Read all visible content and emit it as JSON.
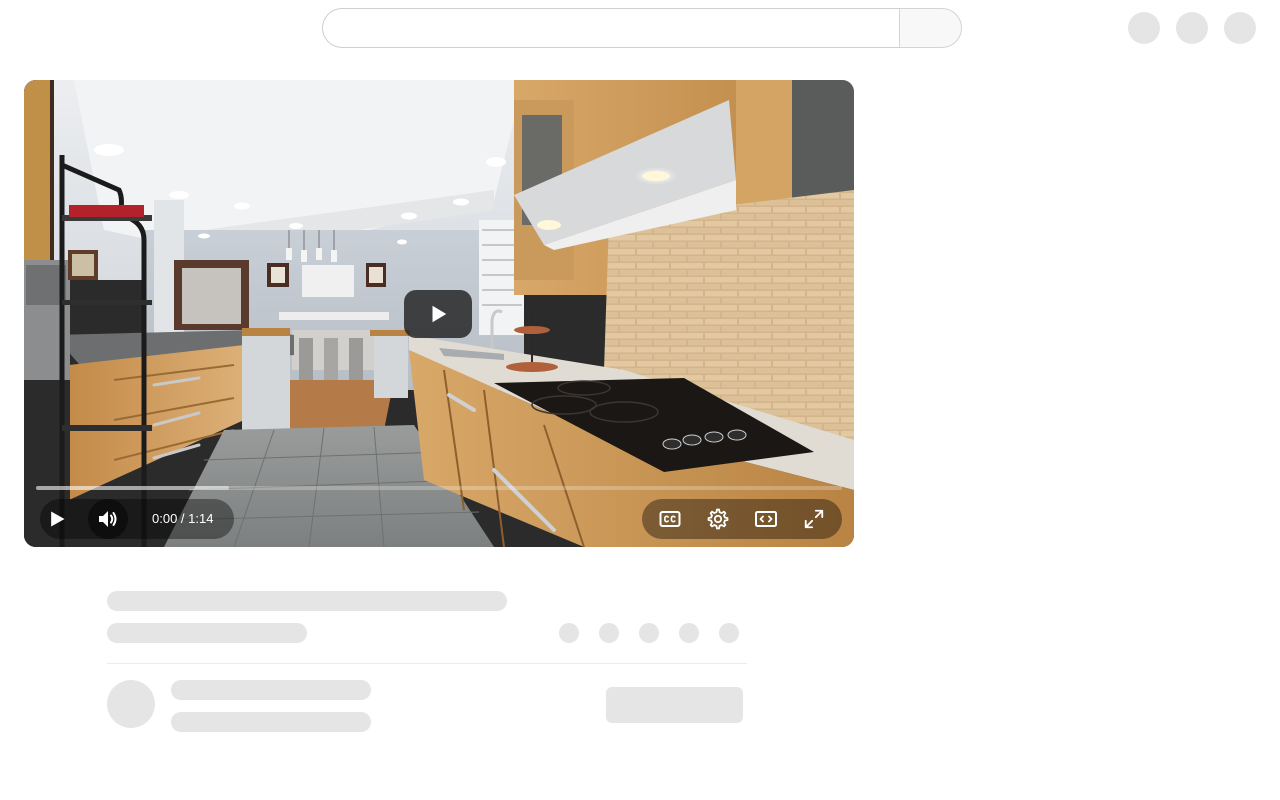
{
  "header": {
    "search": {
      "value": "",
      "placeholder": ""
    },
    "search_button_icon": "search-icon",
    "actions": [
      "create-icon",
      "notifications-icon",
      "account-avatar"
    ]
  },
  "player": {
    "time": {
      "current": "0:00",
      "separator": " / ",
      "duration": "1:14"
    },
    "progress": {
      "played_fraction": 0.0,
      "buffered_fraction": 0.24
    },
    "controls": {
      "left": [
        "play-icon",
        "volume-icon"
      ],
      "right": [
        "closed-captions-icon",
        "settings-icon",
        "theater-mode-icon",
        "fullscreen-icon"
      ]
    },
    "overlay_icon": "large-play-icon"
  },
  "colors": {
    "skeleton": "#e5e5e5",
    "search_border": "#cfcfcf",
    "overlay": "#212121"
  }
}
